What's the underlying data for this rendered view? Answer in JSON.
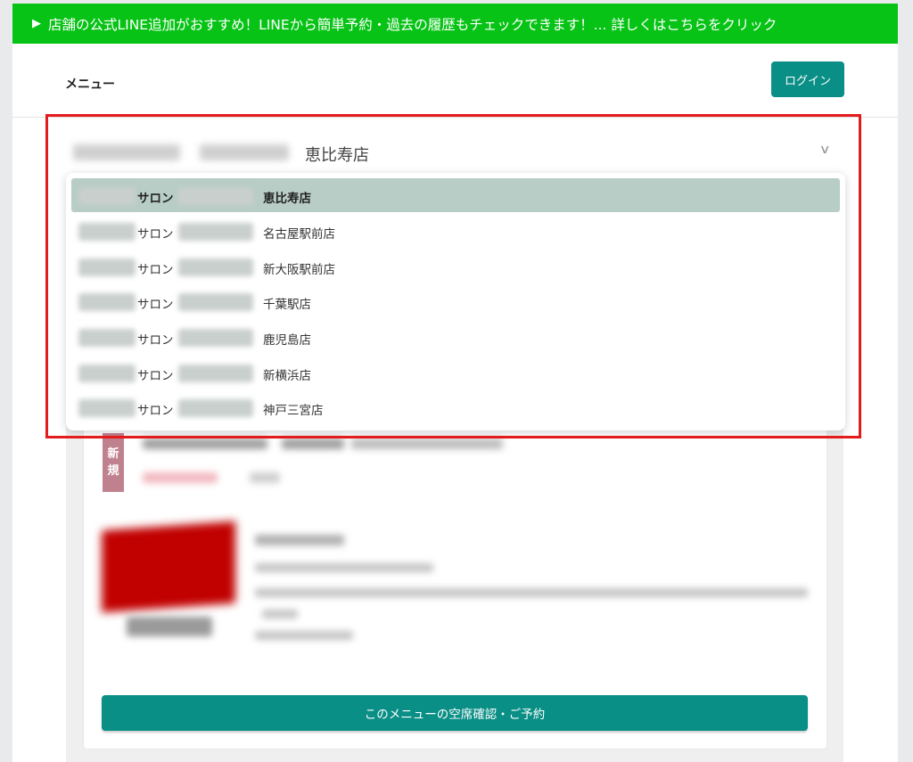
{
  "banner": {
    "marker": "▶",
    "text": "店舗の公式LINE追加がおすすめ！LINEから簡単予約・過去の履歴もチェックできます！... 詳しくはこちらをクリック"
  },
  "header": {
    "menu_label": "メニュー",
    "login_label": "ログイン"
  },
  "store_select": {
    "selected_value": "恵比寿店",
    "chevron": "chevron-down-icon",
    "options": [
      {
        "salon": "サロン",
        "store": "恵比寿店",
        "selected": true
      },
      {
        "salon": "サロン",
        "store": "名古屋駅前店",
        "selected": false
      },
      {
        "salon": "サロン",
        "store": "新大阪駅前店",
        "selected": false
      },
      {
        "salon": "サロン",
        "store": "千葉駅店",
        "selected": false
      },
      {
        "salon": "サロン",
        "store": "鹿児島店",
        "selected": false
      },
      {
        "salon": "サロン",
        "store": "新横浜店",
        "selected": false
      },
      {
        "salon": "サロン",
        "store": "神戸三宮店",
        "selected": false
      }
    ]
  },
  "menu_card": {
    "badge_line1": "新",
    "badge_line2": "規",
    "reserve_label": "このメニューの空席確認・ご予約"
  },
  "colors": {
    "line_green": "#06c315",
    "accent_teal": "#0a8f86",
    "selected_option": "#b8cdc6",
    "annotation_red": "#e31b1b",
    "badge": "#c0818f"
  }
}
